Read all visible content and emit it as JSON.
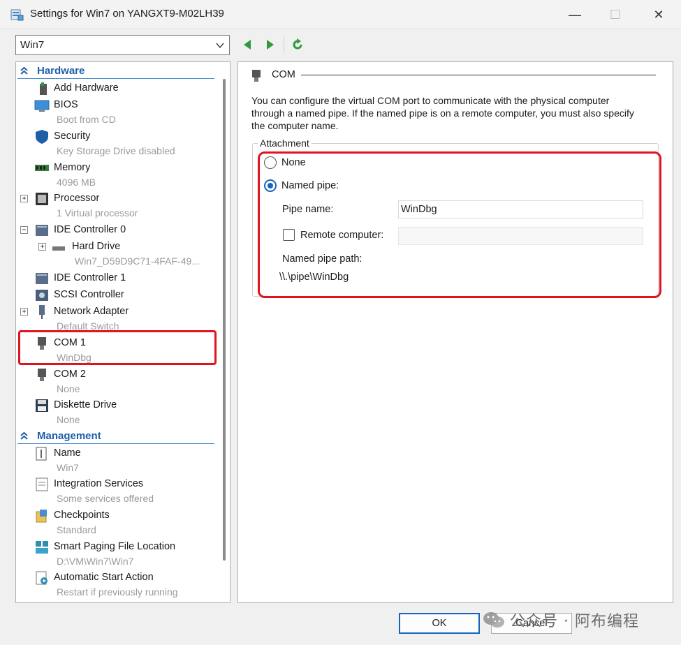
{
  "window": {
    "title": "Settings for Win7 on YANGXT9-M02LH39",
    "minimize_glyph": "—",
    "maximize_glyph": "☐",
    "close_glyph": "✕"
  },
  "vm_selector": {
    "value": "Win7"
  },
  "toolbar": {
    "back_icon": "green-left-arrow",
    "forward_icon": "green-right-arrow",
    "refresh_icon": "green-refresh"
  },
  "sidebar": {
    "hardware_label": "Hardware",
    "management_label": "Management",
    "hardware_items": [
      {
        "name": "Add Hardware",
        "sub": ""
      },
      {
        "name": "BIOS",
        "sub": "Boot from CD"
      },
      {
        "name": "Security",
        "sub": "Key Storage Drive disabled"
      },
      {
        "name": "Memory",
        "sub": "4096 MB"
      },
      {
        "name": "Processor",
        "sub": "1 Virtual processor"
      },
      {
        "name": "IDE Controller 0",
        "sub": ""
      },
      {
        "name": "Hard Drive",
        "sub": "Win7_D59D9C71-4FAF-49..."
      },
      {
        "name": "IDE Controller 1",
        "sub": ""
      },
      {
        "name": "SCSI Controller",
        "sub": ""
      },
      {
        "name": "Network Adapter",
        "sub": "Default Switch"
      },
      {
        "name": "COM 1",
        "sub": "WinDbg"
      },
      {
        "name": "COM 2",
        "sub": "None"
      },
      {
        "name": "Diskette Drive",
        "sub": "None"
      }
    ],
    "management_items": [
      {
        "name": "Name",
        "sub": "Win7"
      },
      {
        "name": "Integration Services",
        "sub": "Some services offered"
      },
      {
        "name": "Checkpoints",
        "sub": "Standard"
      },
      {
        "name": "Smart Paging File Location",
        "sub": "D:\\VM\\Win7\\Win7"
      },
      {
        "name": "Automatic Start Action",
        "sub": "Restart if previously running"
      }
    ]
  },
  "detail": {
    "header": "COM",
    "description": "You can configure the virtual COM port to communicate with the physical computer through a named pipe. If the named pipe is on a remote computer, you must also specify the computer name.",
    "attachment_legend": "Attachment",
    "option_none": "None",
    "option_named_pipe": "Named pipe:",
    "selected_option": "Named pipe",
    "pipe_name_label": "Pipe name:",
    "pipe_name_value": "WinDbg",
    "remote_computer_label": "Remote computer:",
    "remote_computer_value": "",
    "remote_computer_checked": false,
    "named_pipe_path_label": "Named pipe path:",
    "named_pipe_path_value": "\\\\.\\pipe\\WinDbg"
  },
  "footer": {
    "ok_label": "OK",
    "cancel_label": "Cancel"
  },
  "watermark": {
    "text": "公众号 · 阿布编程"
  },
  "colors": {
    "accent_blue": "#1565c0",
    "section_blue": "#1f5fa8",
    "highlight_red": "#e0141f",
    "toolbar_green": "#2e9a3c"
  }
}
